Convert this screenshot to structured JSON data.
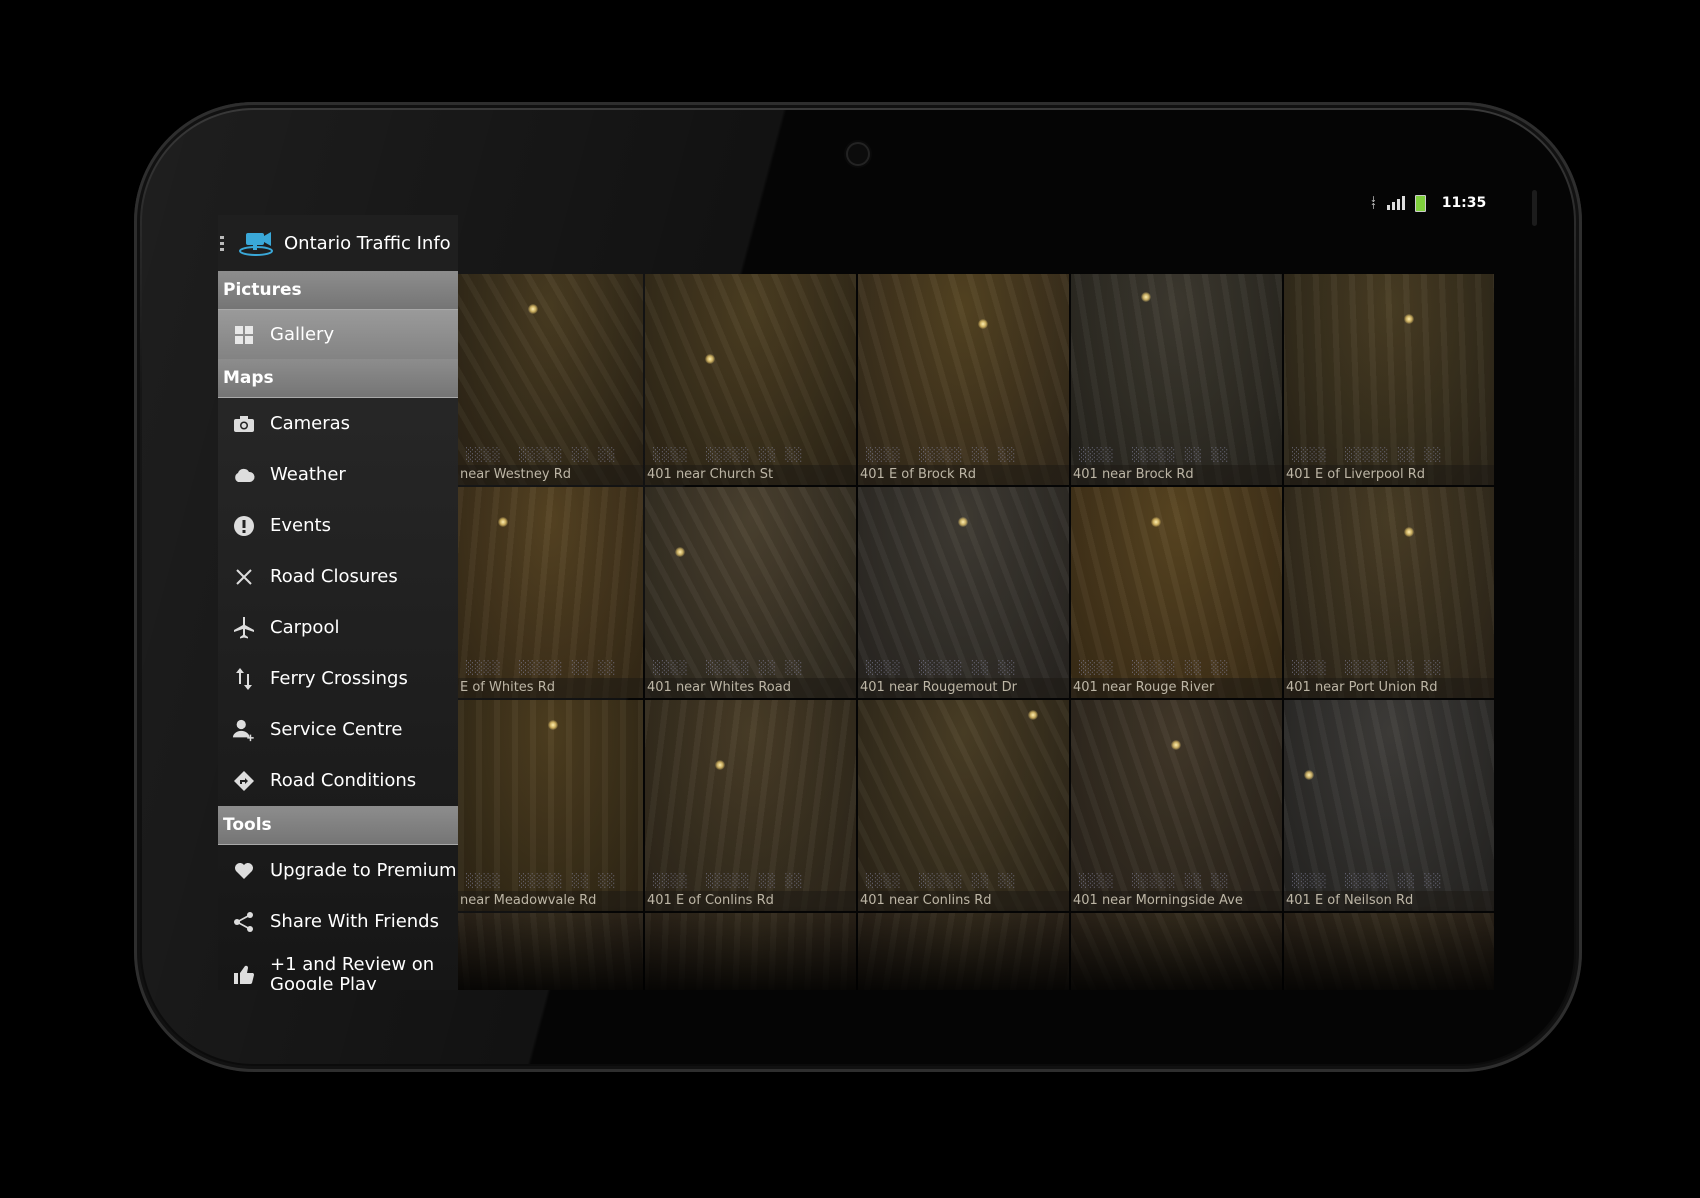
{
  "status_bar": {
    "time": "11:35",
    "network_icon": "signal-icon",
    "battery_icon": "battery-icon"
  },
  "app": {
    "title": "Ontario Traffic Info",
    "icon": "traffic-camera-icon"
  },
  "drawer": {
    "sections": [
      {
        "header": "Pictures",
        "items": [
          {
            "label": "Gallery",
            "icon": "grid-icon",
            "active": true
          }
        ]
      },
      {
        "header": "Maps",
        "items": [
          {
            "label": "Cameras",
            "icon": "camera-icon"
          },
          {
            "label": "Weather",
            "icon": "cloud-icon"
          },
          {
            "label": "Events",
            "icon": "alert-icon"
          },
          {
            "label": "Road Closures",
            "icon": "close-icon"
          },
          {
            "label": "Carpool",
            "icon": "airplane-icon"
          },
          {
            "label": "Ferry Crossings",
            "icon": "up-down-arrows-icon"
          },
          {
            "label": "Service Centre",
            "icon": "person-add-icon"
          },
          {
            "label": "Road Conditions",
            "icon": "directions-icon"
          }
        ]
      },
      {
        "header": "Tools",
        "items": [
          {
            "label": "Upgrade to Premium",
            "icon": "heart-icon"
          },
          {
            "label": "Share With Friends",
            "icon": "share-icon"
          },
          {
            "label": "+1 and Review on Google Play",
            "icon": "thumbs-up-icon"
          }
        ]
      }
    ]
  },
  "gallery": {
    "tiles": [
      "near Westney Rd",
      "401 near Church St",
      "401 E of Brock Rd",
      "401 near Brock Rd",
      "401 E of Liverpool Rd",
      "E of Whites Rd",
      "401 near Whites Road",
      "401 near Rougemout Dr",
      "401 near Rouge River",
      "401 near Port Union Rd",
      "near Meadowvale Rd",
      "401 E of Conlins Rd",
      "401 near Conlins Rd",
      "401 near Morningside Ave",
      "401 E of Neilson Rd",
      "",
      "",
      "",
      "",
      ""
    ]
  }
}
